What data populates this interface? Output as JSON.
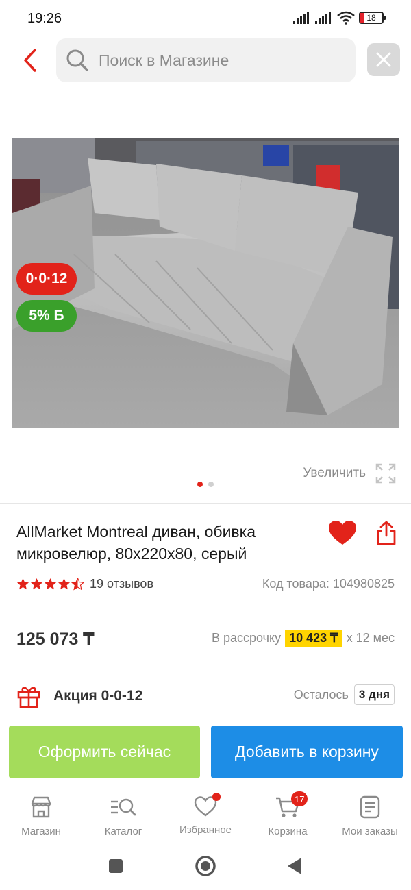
{
  "status_bar": {
    "time": "19:26",
    "battery": "18"
  },
  "search": {
    "placeholder": "Поиск в Магазине"
  },
  "product": {
    "promo_badge": "0·0·12",
    "bonus_badge": "5% Б",
    "zoom_label": "Увеличить",
    "image_count": 2,
    "active_image": 1,
    "title": "AllMarket Montreal диван, обивка микровелюр, 80x220x80, серый",
    "rating": 4.5,
    "reviews": "19 отзывов",
    "sku": "Код товара: 104980825",
    "price": "125 073 ₸",
    "installment_prefix": "В рассрочку",
    "installment_amount": "10 423 ₸",
    "installment_suffix": "x 12 мес",
    "promo_title": "Акция 0-0-12",
    "remaining_label": "Осталось",
    "remaining_days": "3 дня"
  },
  "actions": {
    "buy_now": "Оформить сейчас",
    "add_to_cart": "Добавить в корзину"
  },
  "bottom_nav": {
    "items": [
      {
        "label": "Магазин",
        "icon": "store-icon"
      },
      {
        "label": "Каталог",
        "icon": "catalog-icon"
      },
      {
        "label": "Избранное",
        "icon": "heart-icon"
      },
      {
        "label": "Корзина",
        "icon": "cart-icon",
        "badge": "17"
      },
      {
        "label": "Мои заказы",
        "icon": "orders-icon"
      }
    ]
  },
  "colors": {
    "accent_red": "#e2231a",
    "green_button": "#a4dc5b",
    "blue_button": "#1d8de6",
    "highlight_yellow": "#ffd400"
  }
}
